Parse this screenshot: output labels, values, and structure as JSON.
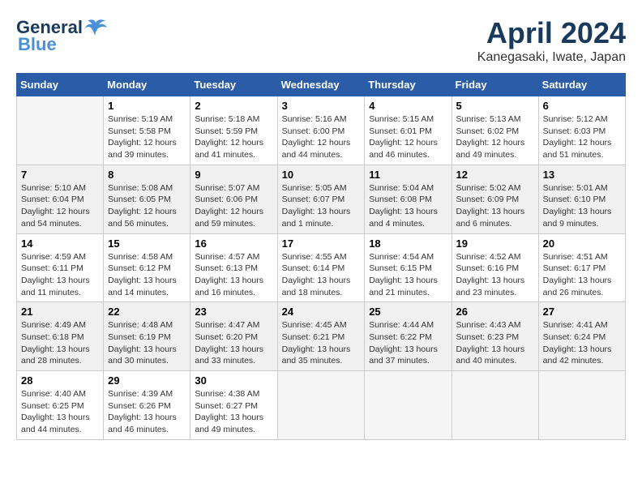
{
  "header": {
    "logo_general": "General",
    "logo_blue": "Blue",
    "month": "April 2024",
    "location": "Kanegasaki, Iwate, Japan"
  },
  "days_of_week": [
    "Sunday",
    "Monday",
    "Tuesday",
    "Wednesday",
    "Thursday",
    "Friday",
    "Saturday"
  ],
  "weeks": [
    [
      {
        "day": "",
        "info": ""
      },
      {
        "day": "1",
        "info": "Sunrise: 5:19 AM\nSunset: 5:58 PM\nDaylight: 12 hours\nand 39 minutes."
      },
      {
        "day": "2",
        "info": "Sunrise: 5:18 AM\nSunset: 5:59 PM\nDaylight: 12 hours\nand 41 minutes."
      },
      {
        "day": "3",
        "info": "Sunrise: 5:16 AM\nSunset: 6:00 PM\nDaylight: 12 hours\nand 44 minutes."
      },
      {
        "day": "4",
        "info": "Sunrise: 5:15 AM\nSunset: 6:01 PM\nDaylight: 12 hours\nand 46 minutes."
      },
      {
        "day": "5",
        "info": "Sunrise: 5:13 AM\nSunset: 6:02 PM\nDaylight: 12 hours\nand 49 minutes."
      },
      {
        "day": "6",
        "info": "Sunrise: 5:12 AM\nSunset: 6:03 PM\nDaylight: 12 hours\nand 51 minutes."
      }
    ],
    [
      {
        "day": "7",
        "info": "Sunrise: 5:10 AM\nSunset: 6:04 PM\nDaylight: 12 hours\nand 54 minutes."
      },
      {
        "day": "8",
        "info": "Sunrise: 5:08 AM\nSunset: 6:05 PM\nDaylight: 12 hours\nand 56 minutes."
      },
      {
        "day": "9",
        "info": "Sunrise: 5:07 AM\nSunset: 6:06 PM\nDaylight: 12 hours\nand 59 minutes."
      },
      {
        "day": "10",
        "info": "Sunrise: 5:05 AM\nSunset: 6:07 PM\nDaylight: 13 hours\nand 1 minute."
      },
      {
        "day": "11",
        "info": "Sunrise: 5:04 AM\nSunset: 6:08 PM\nDaylight: 13 hours\nand 4 minutes."
      },
      {
        "day": "12",
        "info": "Sunrise: 5:02 AM\nSunset: 6:09 PM\nDaylight: 13 hours\nand 6 minutes."
      },
      {
        "day": "13",
        "info": "Sunrise: 5:01 AM\nSunset: 6:10 PM\nDaylight: 13 hours\nand 9 minutes."
      }
    ],
    [
      {
        "day": "14",
        "info": "Sunrise: 4:59 AM\nSunset: 6:11 PM\nDaylight: 13 hours\nand 11 minutes."
      },
      {
        "day": "15",
        "info": "Sunrise: 4:58 AM\nSunset: 6:12 PM\nDaylight: 13 hours\nand 14 minutes."
      },
      {
        "day": "16",
        "info": "Sunrise: 4:57 AM\nSunset: 6:13 PM\nDaylight: 13 hours\nand 16 minutes."
      },
      {
        "day": "17",
        "info": "Sunrise: 4:55 AM\nSunset: 6:14 PM\nDaylight: 13 hours\nand 18 minutes."
      },
      {
        "day": "18",
        "info": "Sunrise: 4:54 AM\nSunset: 6:15 PM\nDaylight: 13 hours\nand 21 minutes."
      },
      {
        "day": "19",
        "info": "Sunrise: 4:52 AM\nSunset: 6:16 PM\nDaylight: 13 hours\nand 23 minutes."
      },
      {
        "day": "20",
        "info": "Sunrise: 4:51 AM\nSunset: 6:17 PM\nDaylight: 13 hours\nand 26 minutes."
      }
    ],
    [
      {
        "day": "21",
        "info": "Sunrise: 4:49 AM\nSunset: 6:18 PM\nDaylight: 13 hours\nand 28 minutes."
      },
      {
        "day": "22",
        "info": "Sunrise: 4:48 AM\nSunset: 6:19 PM\nDaylight: 13 hours\nand 30 minutes."
      },
      {
        "day": "23",
        "info": "Sunrise: 4:47 AM\nSunset: 6:20 PM\nDaylight: 13 hours\nand 33 minutes."
      },
      {
        "day": "24",
        "info": "Sunrise: 4:45 AM\nSunset: 6:21 PM\nDaylight: 13 hours\nand 35 minutes."
      },
      {
        "day": "25",
        "info": "Sunrise: 4:44 AM\nSunset: 6:22 PM\nDaylight: 13 hours\nand 37 minutes."
      },
      {
        "day": "26",
        "info": "Sunrise: 4:43 AM\nSunset: 6:23 PM\nDaylight: 13 hours\nand 40 minutes."
      },
      {
        "day": "27",
        "info": "Sunrise: 4:41 AM\nSunset: 6:24 PM\nDaylight: 13 hours\nand 42 minutes."
      }
    ],
    [
      {
        "day": "28",
        "info": "Sunrise: 4:40 AM\nSunset: 6:25 PM\nDaylight: 13 hours\nand 44 minutes."
      },
      {
        "day": "29",
        "info": "Sunrise: 4:39 AM\nSunset: 6:26 PM\nDaylight: 13 hours\nand 46 minutes."
      },
      {
        "day": "30",
        "info": "Sunrise: 4:38 AM\nSunset: 6:27 PM\nDaylight: 13 hours\nand 49 minutes."
      },
      {
        "day": "",
        "info": ""
      },
      {
        "day": "",
        "info": ""
      },
      {
        "day": "",
        "info": ""
      },
      {
        "day": "",
        "info": ""
      }
    ]
  ]
}
